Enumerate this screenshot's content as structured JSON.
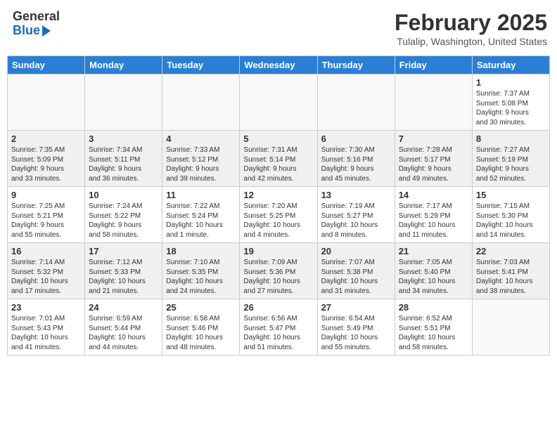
{
  "header": {
    "logo_line1": "General",
    "logo_line2": "Blue",
    "month": "February 2025",
    "location": "Tulalip, Washington, United States"
  },
  "days_of_week": [
    "Sunday",
    "Monday",
    "Tuesday",
    "Wednesday",
    "Thursday",
    "Friday",
    "Saturday"
  ],
  "weeks": [
    {
      "shaded": false,
      "days": [
        {
          "num": "",
          "info": ""
        },
        {
          "num": "",
          "info": ""
        },
        {
          "num": "",
          "info": ""
        },
        {
          "num": "",
          "info": ""
        },
        {
          "num": "",
          "info": ""
        },
        {
          "num": "",
          "info": ""
        },
        {
          "num": "1",
          "info": "Sunrise: 7:37 AM\nSunset: 5:08 PM\nDaylight: 9 hours\nand 30 minutes."
        }
      ]
    },
    {
      "shaded": true,
      "days": [
        {
          "num": "2",
          "info": "Sunrise: 7:35 AM\nSunset: 5:09 PM\nDaylight: 9 hours\nand 33 minutes."
        },
        {
          "num": "3",
          "info": "Sunrise: 7:34 AM\nSunset: 5:11 PM\nDaylight: 9 hours\nand 36 minutes."
        },
        {
          "num": "4",
          "info": "Sunrise: 7:33 AM\nSunset: 5:12 PM\nDaylight: 9 hours\nand 39 minutes."
        },
        {
          "num": "5",
          "info": "Sunrise: 7:31 AM\nSunset: 5:14 PM\nDaylight: 9 hours\nand 42 minutes."
        },
        {
          "num": "6",
          "info": "Sunrise: 7:30 AM\nSunset: 5:16 PM\nDaylight: 9 hours\nand 45 minutes."
        },
        {
          "num": "7",
          "info": "Sunrise: 7:28 AM\nSunset: 5:17 PM\nDaylight: 9 hours\nand 49 minutes."
        },
        {
          "num": "8",
          "info": "Sunrise: 7:27 AM\nSunset: 5:19 PM\nDaylight: 9 hours\nand 52 minutes."
        }
      ]
    },
    {
      "shaded": false,
      "days": [
        {
          "num": "9",
          "info": "Sunrise: 7:25 AM\nSunset: 5:21 PM\nDaylight: 9 hours\nand 55 minutes."
        },
        {
          "num": "10",
          "info": "Sunrise: 7:24 AM\nSunset: 5:22 PM\nDaylight: 9 hours\nand 58 minutes."
        },
        {
          "num": "11",
          "info": "Sunrise: 7:22 AM\nSunset: 5:24 PM\nDaylight: 10 hours\nand 1 minute."
        },
        {
          "num": "12",
          "info": "Sunrise: 7:20 AM\nSunset: 5:25 PM\nDaylight: 10 hours\nand 4 minutes."
        },
        {
          "num": "13",
          "info": "Sunrise: 7:19 AM\nSunset: 5:27 PM\nDaylight: 10 hours\nand 8 minutes."
        },
        {
          "num": "14",
          "info": "Sunrise: 7:17 AM\nSunset: 5:29 PM\nDaylight: 10 hours\nand 11 minutes."
        },
        {
          "num": "15",
          "info": "Sunrise: 7:15 AM\nSunset: 5:30 PM\nDaylight: 10 hours\nand 14 minutes."
        }
      ]
    },
    {
      "shaded": true,
      "days": [
        {
          "num": "16",
          "info": "Sunrise: 7:14 AM\nSunset: 5:32 PM\nDaylight: 10 hours\nand 17 minutes."
        },
        {
          "num": "17",
          "info": "Sunrise: 7:12 AM\nSunset: 5:33 PM\nDaylight: 10 hours\nand 21 minutes."
        },
        {
          "num": "18",
          "info": "Sunrise: 7:10 AM\nSunset: 5:35 PM\nDaylight: 10 hours\nand 24 minutes."
        },
        {
          "num": "19",
          "info": "Sunrise: 7:09 AM\nSunset: 5:36 PM\nDaylight: 10 hours\nand 27 minutes."
        },
        {
          "num": "20",
          "info": "Sunrise: 7:07 AM\nSunset: 5:38 PM\nDaylight: 10 hours\nand 31 minutes."
        },
        {
          "num": "21",
          "info": "Sunrise: 7:05 AM\nSunset: 5:40 PM\nDaylight: 10 hours\nand 34 minutes."
        },
        {
          "num": "22",
          "info": "Sunrise: 7:03 AM\nSunset: 5:41 PM\nDaylight: 10 hours\nand 38 minutes."
        }
      ]
    },
    {
      "shaded": false,
      "days": [
        {
          "num": "23",
          "info": "Sunrise: 7:01 AM\nSunset: 5:43 PM\nDaylight: 10 hours\nand 41 minutes."
        },
        {
          "num": "24",
          "info": "Sunrise: 6:59 AM\nSunset: 5:44 PM\nDaylight: 10 hours\nand 44 minutes."
        },
        {
          "num": "25",
          "info": "Sunrise: 6:58 AM\nSunset: 5:46 PM\nDaylight: 10 hours\nand 48 minutes."
        },
        {
          "num": "26",
          "info": "Sunrise: 6:56 AM\nSunset: 5:47 PM\nDaylight: 10 hours\nand 51 minutes."
        },
        {
          "num": "27",
          "info": "Sunrise: 6:54 AM\nSunset: 5:49 PM\nDaylight: 10 hours\nand 55 minutes."
        },
        {
          "num": "28",
          "info": "Sunrise: 6:52 AM\nSunset: 5:51 PM\nDaylight: 10 hours\nand 58 minutes."
        },
        {
          "num": "",
          "info": ""
        }
      ]
    }
  ]
}
